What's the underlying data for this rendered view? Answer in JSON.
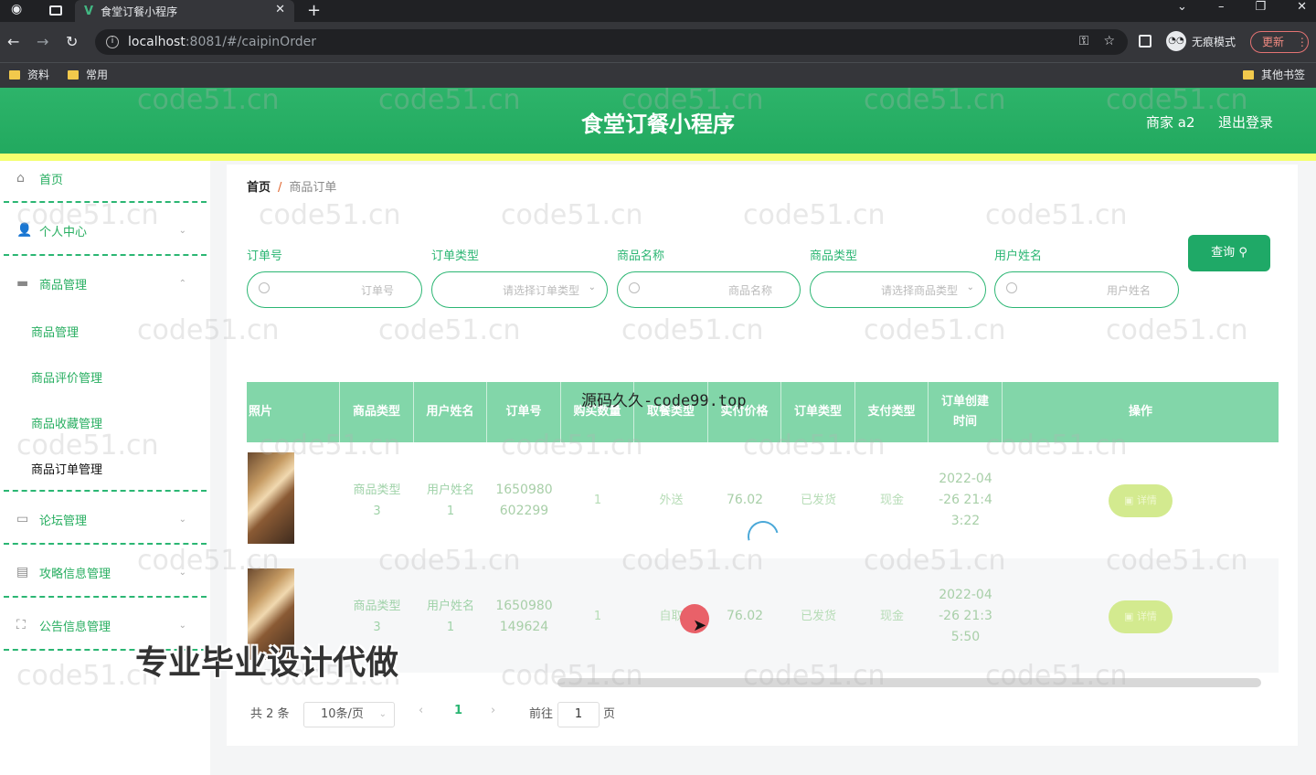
{
  "browser": {
    "tab_title": "食堂订餐小程序",
    "url_host": "localhost",
    "url_path": ":8081/#/caipinOrder",
    "incognito_label": "无痕模式",
    "update_label": "更新",
    "bookmarks": [
      "资料",
      "常用"
    ],
    "other_bookmarks": "其他书签"
  },
  "header": {
    "title": "食堂订餐小程序",
    "user": "商家 a2",
    "logout": "退出登录",
    "accent": "#27ae60"
  },
  "sidebar": {
    "items": [
      {
        "label": "首页",
        "icon": "home-icon"
      },
      {
        "label": "个人中心",
        "icon": "user-icon"
      },
      {
        "label": "商品管理",
        "icon": "briefcase-icon"
      },
      {
        "label": "论坛管理",
        "icon": "message-icon"
      },
      {
        "label": "攻略信息管理",
        "icon": "document-icon"
      },
      {
        "label": "公告信息管理",
        "icon": "fullscreen-icon"
      }
    ],
    "sub_items": [
      "商品管理",
      "商品评价管理",
      "商品收藏管理",
      "商品订单管理"
    ]
  },
  "breadcrumb": {
    "home": "首页",
    "sep": "/",
    "current": "商品订单"
  },
  "filters": [
    {
      "label": "订单号",
      "placeholder": "订单号"
    },
    {
      "label": "订单类型",
      "placeholder": "请选择订单类型"
    },
    {
      "label": "商品名称",
      "placeholder": "商品名称"
    },
    {
      "label": "商品类型",
      "placeholder": "请选择商品类型"
    },
    {
      "label": "用户姓名",
      "placeholder": "用户姓名"
    }
  ],
  "query_button": "查询",
  "table": {
    "columns": [
      "照片",
      "商品类型",
      "用户姓名",
      "订单号",
      "购买数量",
      "取餐类型",
      "实付价格",
      "订单类型",
      "支付类型",
      "订单创建\n时间",
      "操作"
    ],
    "rows": [
      {
        "type": "商品类型\n3",
        "user": "用户姓名\n1",
        "order_no": "1650980\n602299",
        "qty": "1",
        "pickup": "外送",
        "price": "76.02",
        "status": "已发货",
        "pay": "现金",
        "created": "2022-04\n-26 21:4\n3:22",
        "action": "详情"
      },
      {
        "type": "商品类型\n3",
        "user": "用户姓名\n1",
        "order_no": "1650980\n149624",
        "qty": "1",
        "pickup": "自取",
        "price": "76.02",
        "status": "已发货",
        "pay": "现金",
        "created": "2022-04\n-26 21:3\n5:50",
        "action": "详情"
      }
    ]
  },
  "pagination": {
    "total": "共 2 条",
    "page_size": "10条/页",
    "current_page": "1",
    "goto_prefix": "前往",
    "goto_value": "1",
    "goto_suffix": "页"
  },
  "overlays": {
    "watermark": "code51.cn",
    "banner_top": "源码久久-code99.top",
    "banner_bottom": "专业毕业设计代做"
  }
}
